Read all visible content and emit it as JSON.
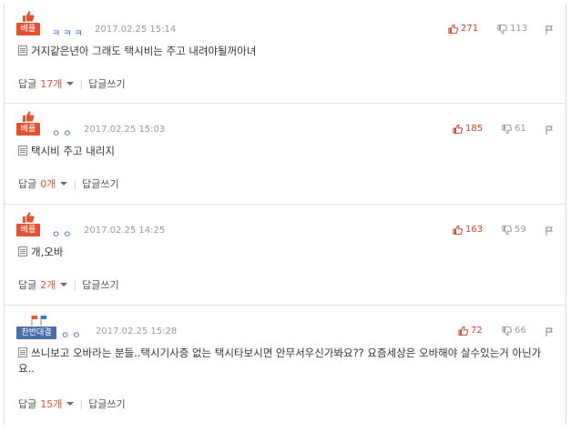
{
  "comments": [
    {
      "badge": "베플",
      "nickname": "ㅋㅋㅋ",
      "date": "2017.02.25 15:14",
      "likes": "271",
      "dislikes": "113",
      "text": "거지같은년아 그래도 택시비는 주고 내려야될꺼아녀",
      "reply_label": "답글",
      "reply_count": "17개",
      "write_reply": "답글쓰기"
    },
    {
      "badge": "베플",
      "nickname": "ㅇㅇ",
      "date": "2017.02.25 15:03",
      "likes": "185",
      "dislikes": "61",
      "text": "택시비 주고 내리지",
      "reply_label": "답글",
      "reply_count": "0개",
      "write_reply": "답글쓰기"
    },
    {
      "badge": "베플",
      "nickname": "ㅇㅇ",
      "date": "2017.02.25 14:25",
      "likes": "163",
      "dislikes": "59",
      "text": "개,오바",
      "reply_label": "답글",
      "reply_count": "2개",
      "write_reply": "답글쓰기"
    },
    {
      "badge": "찬반대결",
      "nickname": "ㅇㅇ",
      "date": "2017.02.25 15:28",
      "likes": "72",
      "dislikes": "66",
      "text": "쓰니보고 오바라는 분들..택시기사증 없는 택시타보시면 안무서우신가봐요?? 요즘세상은 오바해야 살수있는거 아닌가요..",
      "reply_label": "답글",
      "reply_count": "15개",
      "write_reply": "답글쓰기"
    }
  ],
  "icons": {
    "thumb": "thumb-up-icon",
    "like": "thumb-up-icon",
    "dislike": "thumb-down-icon",
    "report": "report-icon",
    "doc": "document-icon"
  },
  "colors": {
    "best_badge": "#e15335",
    "versus_badge": "#4a6ea8",
    "like": "#c9402b",
    "nickname": "#3a5fcd"
  }
}
